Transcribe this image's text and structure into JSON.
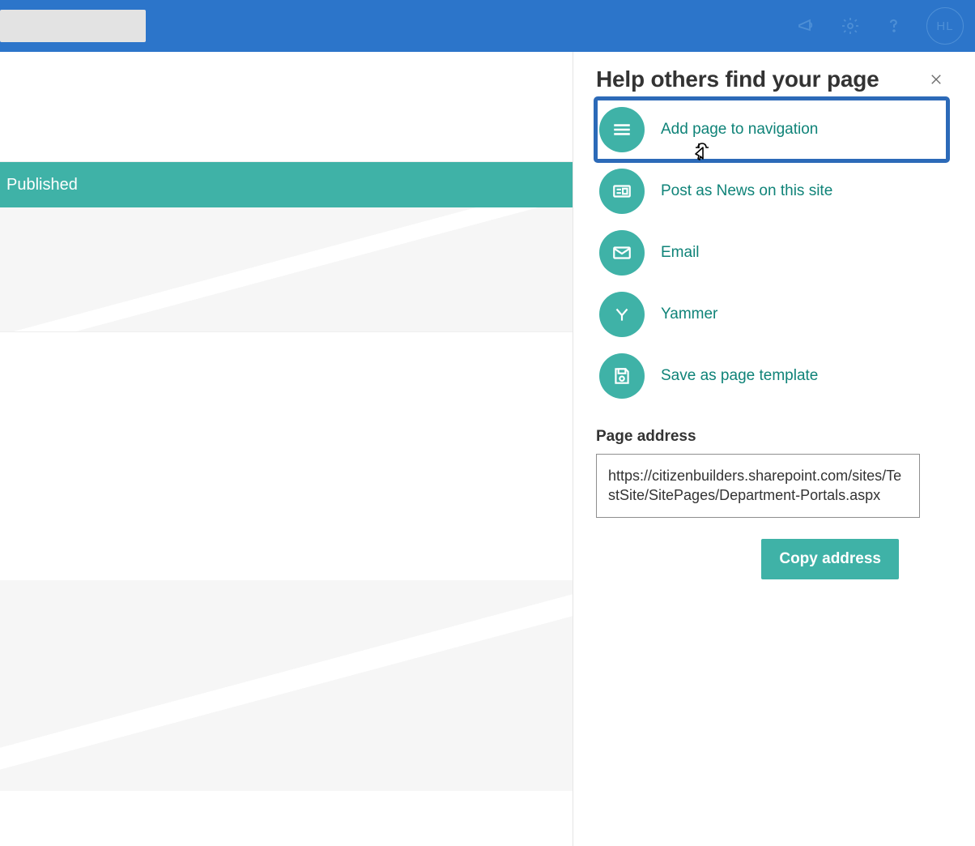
{
  "topbar": {
    "user_initials": "HL"
  },
  "banner": {
    "status": "Published"
  },
  "panel": {
    "title": "Help others find your page",
    "options": [
      {
        "icon": "menu-icon",
        "label": "Add page to navigation"
      },
      {
        "icon": "news-icon",
        "label": "Post as News on this site"
      },
      {
        "icon": "email-icon",
        "label": "Email"
      },
      {
        "icon": "yammer-icon",
        "label": "Yammer"
      },
      {
        "icon": "save-icon",
        "label": "Save as page template"
      }
    ],
    "address_label": "Page address",
    "address_value": "https://citizenbuilders.sharepoint.com/sites/TestSite/SitePages/Department-Portals.aspx",
    "copy_label": "Copy address"
  }
}
